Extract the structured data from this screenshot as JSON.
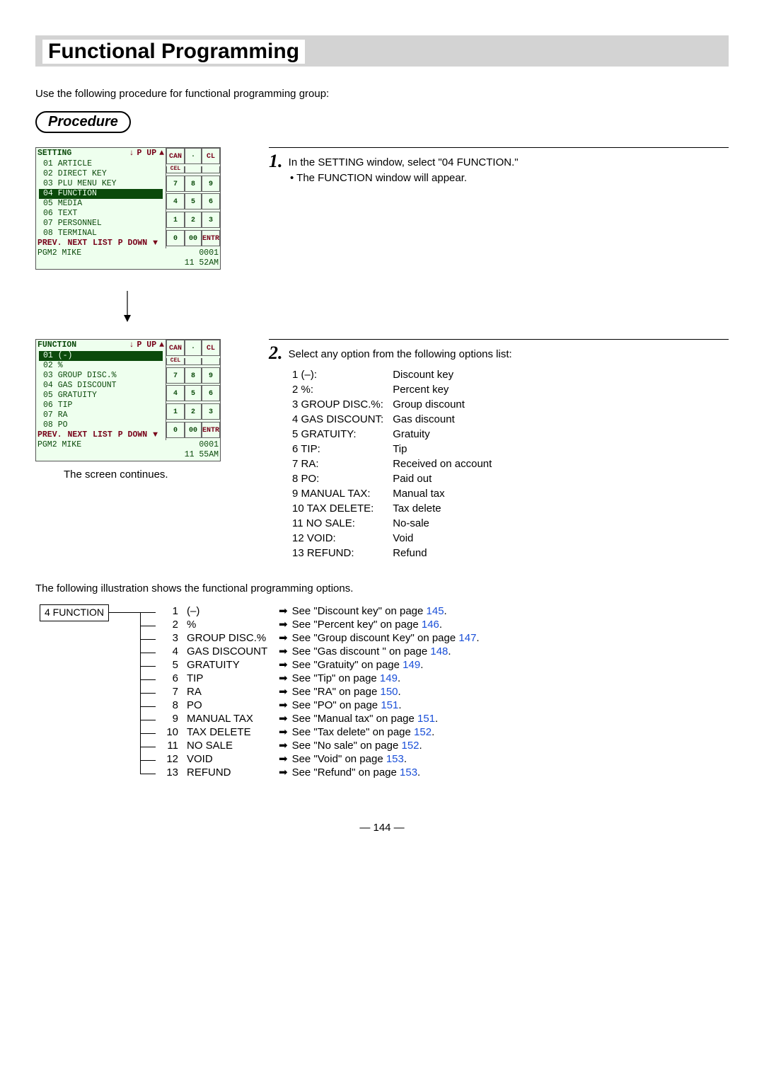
{
  "title": "Functional Programming",
  "intro": "Use the following procedure for functional programming group:",
  "procedure_label": "Procedure",
  "step1": {
    "text": "In the SETTING window, select \"04 FUNCTION.\"",
    "bullet": "The FUNCTION window will appear."
  },
  "step2": {
    "text": "Select any option from the following options list:"
  },
  "screen_continues": "The screen continues.",
  "screen1": {
    "title": "SETTING",
    "nav": {
      "down": "↓",
      "pup": "P UP",
      "up": "▲"
    },
    "rows": [
      {
        "txt": "01 ARTICLE",
        "sel": false
      },
      {
        "txt": "02 DIRECT KEY",
        "sel": false
      },
      {
        "txt": "03 PLU MENU KEY",
        "sel": false
      },
      {
        "txt": "04 FUNCTION",
        "sel": true
      },
      {
        "txt": "05 MEDIA",
        "sel": false
      },
      {
        "txt": "06 TEXT",
        "sel": false
      },
      {
        "txt": "07 PERSONNEL",
        "sel": false
      },
      {
        "txt": "08 TERMINAL",
        "sel": false
      }
    ],
    "footer1": [
      "PREV.",
      "NEXT",
      "LIST",
      "P DOWN",
      "▼"
    ],
    "footer2": "PGM2   MIKE",
    "footer3_a": "0001",
    "footer3_b": "11 52AM"
  },
  "screen2": {
    "title": "FUNCTION",
    "nav": {
      "down": "↓",
      "pup": "P UP",
      "up": "▲"
    },
    "rows": [
      {
        "txt": "01 (-)",
        "sel": true
      },
      {
        "txt": "02 %",
        "sel": false
      },
      {
        "txt": "03 GROUP DISC.%",
        "sel": false
      },
      {
        "txt": "04 GAS DISCOUNT",
        "sel": false
      },
      {
        "txt": "05 GRATUITY",
        "sel": false
      },
      {
        "txt": "06 TIP",
        "sel": false
      },
      {
        "txt": "07 RA",
        "sel": false
      },
      {
        "txt": "08 PO",
        "sel": false
      }
    ],
    "footer1": [
      "PREV.",
      "NEXT",
      "LIST",
      "P DOWN",
      "▼"
    ],
    "footer2": "PGM2   MIKE",
    "footer3_a": "0001",
    "footer3_b": "11 55AM"
  },
  "keypad": [
    [
      "CAN",
      "·",
      "CL"
    ],
    [
      "CEL",
      "",
      ""
    ],
    [
      "7",
      "8",
      "9"
    ],
    [
      "4",
      "5",
      "6"
    ],
    [
      "1",
      "2",
      "3"
    ],
    [
      "0",
      "00",
      "ENTR"
    ]
  ],
  "options": [
    {
      "k": "1 (–):",
      "v": "Discount key"
    },
    {
      "k": "2 %:",
      "v": "Percent key"
    },
    {
      "k": "3 GROUP DISC.%:",
      "v": "Group discount"
    },
    {
      "k": "4 GAS DISCOUNT:",
      "v": "Gas discount"
    },
    {
      "k": "5 GRATUITY:",
      "v": "Gratuity"
    },
    {
      "k": "6 TIP:",
      "v": "Tip"
    },
    {
      "k": "7 RA:",
      "v": "Received on account"
    },
    {
      "k": "8 PO:",
      "v": "Paid out"
    },
    {
      "k": "9 MANUAL TAX:",
      "v": "Manual tax"
    },
    {
      "k": "10 TAX DELETE:",
      "v": "Tax delete"
    },
    {
      "k": "11 NO SALE:",
      "v": "No-sale"
    },
    {
      "k": "12 VOID:",
      "v": "Void"
    },
    {
      "k": "13 REFUND:",
      "v": "Refund"
    }
  ],
  "tree_intro": "The following illustration shows the functional programming options.",
  "tree_root": "4 FUNCTION",
  "tree_branches": [
    {
      "n": "1",
      "name": "(–)",
      "see_a": "See \"Discount key\" on page ",
      "page": "145",
      "see_b": "."
    },
    {
      "n": "2",
      "name": "%",
      "see_a": "See \"Percent key\" on page ",
      "page": "146",
      "see_b": "."
    },
    {
      "n": "3",
      "name": "GROUP DISC.%",
      "see_a": "See \"Group discount Key\" on page ",
      "page": "147",
      "see_b": "."
    },
    {
      "n": "4",
      "name": "GAS DISCOUNT",
      "see_a": "See \"Gas discount  \" on page ",
      "page": "148",
      "see_b": "."
    },
    {
      "n": "5",
      "name": "GRATUITY",
      "see_a": "See \"Gratuity\" on page ",
      "page": "149",
      "see_b": "."
    },
    {
      "n": "6",
      "name": "TIP",
      "see_a": "See \"Tip\" on page ",
      "page": "149",
      "see_b": "."
    },
    {
      "n": "7",
      "name": "RA",
      "see_a": "See \"RA\" on page ",
      "page": "150",
      "see_b": "."
    },
    {
      "n": "8",
      "name": "PO",
      "see_a": "See \"PO\" on page ",
      "page": "151",
      "see_b": "."
    },
    {
      "n": "9",
      "name": "MANUAL TAX",
      "see_a": "See \"Manual tax\" on page ",
      "page": "151",
      "see_b": "."
    },
    {
      "n": "10",
      "name": "TAX DELETE",
      "see_a": "See \"Tax delete\" on page ",
      "page": "152",
      "see_b": "."
    },
    {
      "n": "11",
      "name": "NO SALE",
      "see_a": "See \"No sale\" on page ",
      "page": "152",
      "see_b": "."
    },
    {
      "n": "12",
      "name": "VOID",
      "see_a": "See \"Void\" on page ",
      "page": "153",
      "see_b": "."
    },
    {
      "n": "13",
      "name": "REFUND",
      "see_a": "See \"Refund\" on page ",
      "page": "153",
      "see_b": "."
    }
  ],
  "arrow_glyph": "➡",
  "page_number": "— 144 —"
}
